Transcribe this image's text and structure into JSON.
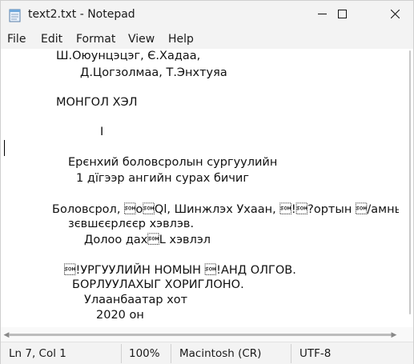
{
  "window": {
    "title": "text2.txt - Notepad"
  },
  "menu": {
    "file": "File",
    "edit": "Edit",
    "format": "Format",
    "view": "View",
    "help": "Help"
  },
  "document": {
    "lines": [
      "Ш.Оюунцэцэг, Є.Хадаа,",
      "Д.Цогзолмаа, Т.Энхтуяа",
      "МОНГОЛ ХЭЛ",
      "I",
      "Ерєнхий боловсролын сургуулийн",
      "1 дїгээр ангийн сурах бичиг",
      "Боловсрол, \u0001o\u0001Ql, Шинжлэх Ухаан, \u0001!\u0001?ортын \u0001/амны",
      "зєвшєєрлєєр хэвлэв.",
      "Долоо дах\u0001L хэвлэл",
      "\u0001!УРГУУЛИЙН НОМЫН \u0001!АНД ОЛГОВ.",
      "БОРЛУУЛАХЫГ ХОРИГЛОНО.",
      "Улаанбаатар хот",
      "2020 он"
    ]
  },
  "status": {
    "position": "Ln 7, Col 1",
    "zoom": "100%",
    "line_ending": "Macintosh (CR)",
    "encoding": "UTF-8"
  },
  "icons": {
    "app": "notepad-icon",
    "minimize": "minimize-icon",
    "maximize": "maximize-icon",
    "close": "close-icon"
  }
}
